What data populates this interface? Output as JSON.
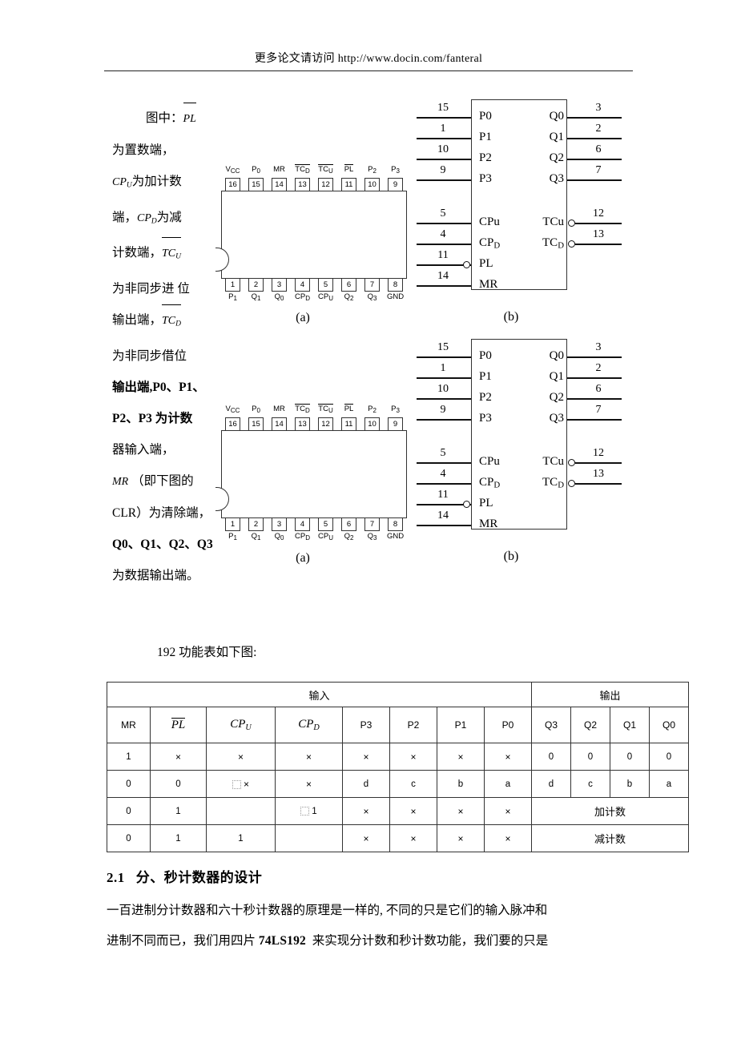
{
  "header": {
    "watermark": "更多论文请访问 http://www.docin.com/fanteral"
  },
  "narrative": {
    "lines": [
      {
        "text": "图中：",
        "math": "PL",
        "style": "overline",
        "indent": true
      },
      {
        "text": "为置数端，"
      },
      {
        "math": "CP",
        "sub": "U",
        "text": "为加计数"
      },
      {
        "text": "端，",
        "math2": "CP",
        "sub2": "D",
        "text2": "为减"
      },
      {
        "text": "计数端，",
        "math": "TC",
        "sub": "U",
        "style": "overline"
      },
      {
        "text": "为非同步进 位"
      },
      {
        "text": "输出端，",
        "math": "TC",
        "sub": "D",
        "style": "overline"
      },
      {
        "text": "为非同步借位"
      },
      {
        "text": "输出端,P0、P1、"
      },
      {
        "text": "P2、P3 为计数"
      },
      {
        "text": "器输入端，"
      },
      {
        "math": "MR",
        "text": "（即下图的"
      },
      {
        "text": "CLR）为清除端，"
      },
      {
        "text": "Q0、Q1、Q2、Q3"
      },
      {
        "text": "为数据输出端。"
      }
    ]
  },
  "dip": {
    "caption": "(a)",
    "top_pins": [
      {
        "num": "16",
        "label": "V",
        "sub": "CC",
        "overline": false
      },
      {
        "num": "15",
        "label": "P",
        "sub": "0",
        "overline": false
      },
      {
        "num": "14",
        "label": "MR",
        "sub": "",
        "overline": false
      },
      {
        "num": "13",
        "label": "TC",
        "sub": "D",
        "overline": true
      },
      {
        "num": "12",
        "label": "TC",
        "sub": "U",
        "overline": true
      },
      {
        "num": "11",
        "label": "PL",
        "sub": "",
        "overline": true
      },
      {
        "num": "10",
        "label": "P",
        "sub": "2",
        "overline": false
      },
      {
        "num": "9",
        "label": "P",
        "sub": "3",
        "overline": false
      }
    ],
    "bottom_pins": [
      {
        "num": "1",
        "label": "P",
        "sub": "1"
      },
      {
        "num": "2",
        "label": "Q",
        "sub": "1"
      },
      {
        "num": "3",
        "label": "Q",
        "sub": "0"
      },
      {
        "num": "4",
        "label": "CP",
        "sub": "D"
      },
      {
        "num": "5",
        "label": "CP",
        "sub": "U"
      },
      {
        "num": "6",
        "label": "Q",
        "sub": "2"
      },
      {
        "num": "7",
        "label": "Q",
        "sub": "3"
      },
      {
        "num": "8",
        "label": "GND",
        "sub": ""
      }
    ]
  },
  "symbol": {
    "caption": "(b)",
    "inputs": [
      {
        "pin": "15",
        "name": "P0",
        "bubble": false
      },
      {
        "pin": "1",
        "name": "P1",
        "bubble": false
      },
      {
        "pin": "10",
        "name": "P2",
        "bubble": false
      },
      {
        "pin": "9",
        "name": "P3",
        "bubble": false
      },
      {
        "pin": "5",
        "name": "CPu",
        "sub": "",
        "bubble": false
      },
      {
        "pin": "4",
        "name": "CP",
        "sub": "D",
        "bubble": false
      },
      {
        "pin": "11",
        "name": "PL",
        "bubble": true
      },
      {
        "pin": "14",
        "name": "MR",
        "bubble": false
      }
    ],
    "outputs": [
      {
        "pin": "3",
        "name": "Q0",
        "bubble": false
      },
      {
        "pin": "2",
        "name": "Q1",
        "bubble": false
      },
      {
        "pin": "6",
        "name": "Q2",
        "bubble": false
      },
      {
        "pin": "7",
        "name": "Q3",
        "bubble": false
      },
      {
        "pin": "12",
        "name": "TCu",
        "sub": "",
        "bubble": true
      },
      {
        "pin": "13",
        "name": "TC",
        "sub": "D",
        "bubble": true
      }
    ]
  },
  "table": {
    "caption": "192 功能表如下图:",
    "group_input": "输入",
    "group_output": "输出",
    "columns": [
      "MR",
      "PL",
      "CP",
      "CP",
      "P3",
      "P2",
      "P1",
      "P0",
      "Q3",
      "Q2",
      "Q1",
      "Q0"
    ],
    "col_subs": [
      "",
      "",
      "U",
      "D",
      "",
      "",
      "",
      "",
      "",
      "",
      "",
      ""
    ],
    "rows": [
      {
        "cells": [
          "1",
          "×",
          "×",
          "×",
          "×",
          "×",
          "×",
          "×",
          "0",
          "0",
          "0",
          "0"
        ],
        "span_output": null
      },
      {
        "cells": [
          "0",
          "0",
          "×",
          "×",
          "d",
          "c",
          "b",
          "a",
          "d",
          "c",
          "b",
          "a"
        ],
        "pulse_col": 2,
        "span_output": null
      },
      {
        "cells": [
          "0",
          "1",
          "",
          "1",
          "×",
          "×",
          "×",
          "×"
        ],
        "pulse_col": 3,
        "span_output": "加计数"
      },
      {
        "cells": [
          "0",
          "1",
          "1",
          "",
          "×",
          "×",
          "×",
          "×"
        ],
        "span_output": "减计数"
      }
    ]
  },
  "section": {
    "number": "2.1",
    "title": "分、秒计数器的设计",
    "paragraph_lines": [
      "一百进制分计数器和六十秒计数器的原理是一样的, 不同的只是它们的输入脉冲和",
      "进制不同而已，我们用四片 74LS192  来实现分计数和秒计数功能，我们要的只是"
    ]
  }
}
